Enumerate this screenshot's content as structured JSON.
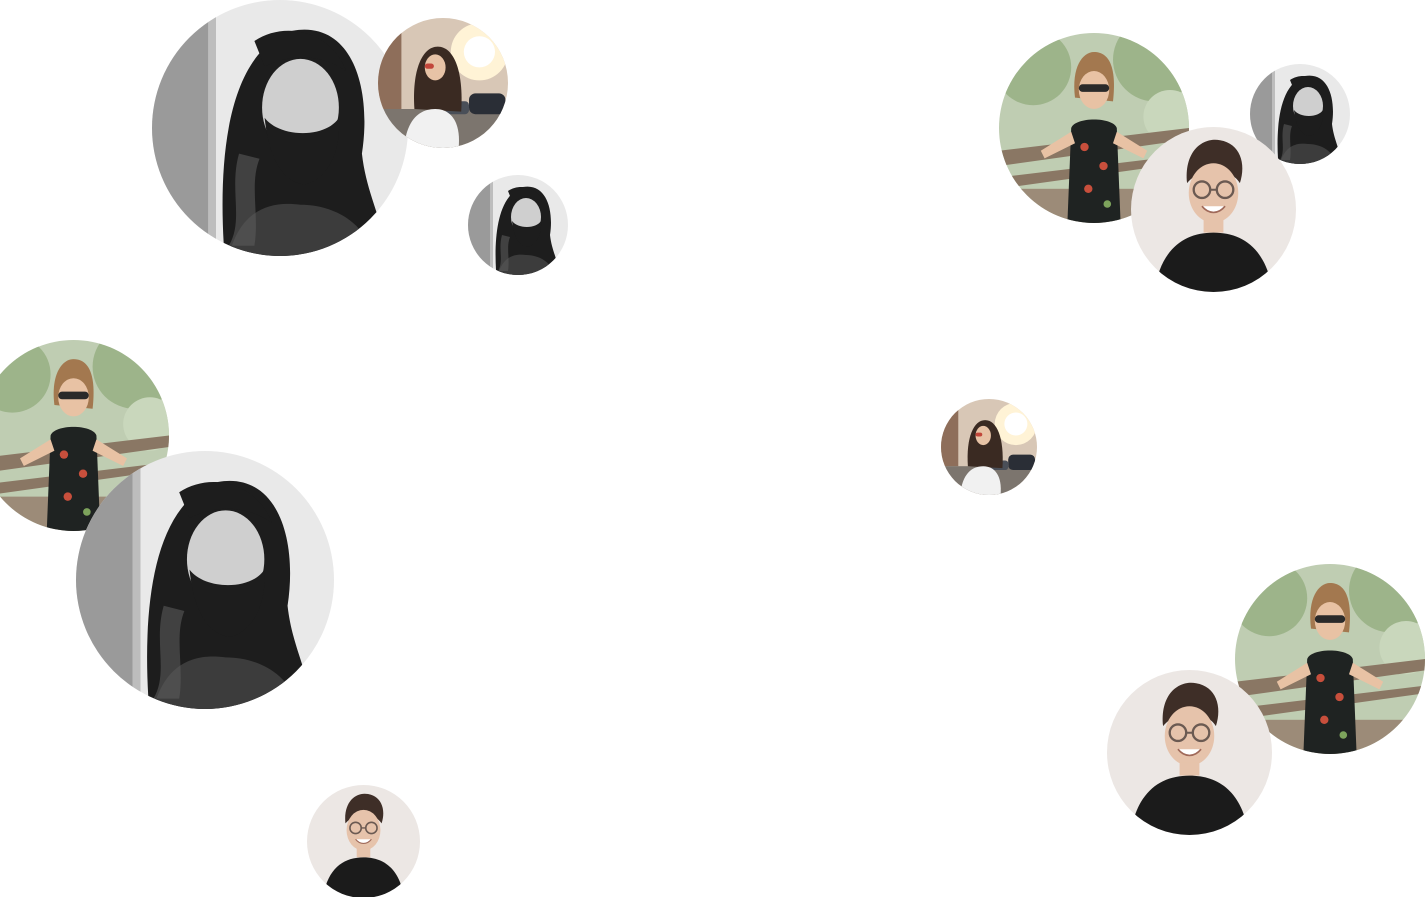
{
  "palette": {
    "background": "#ffffff",
    "bw_bg": "#e9e9e9",
    "bw_wall": "#9a9a9a",
    "bw_hair": "#1d1d1d",
    "bw_skin": "#cfcfcf",
    "bw_shirt": "#3c3c3c",
    "street_bg": "#d8c7b6",
    "street_sun": "#fff3d6",
    "street_hair": "#3a2a22",
    "street_skin": "#e7c3a6",
    "street_top": "#f1f1f1",
    "street_car": "#2a2e36",
    "park_bg": "#bfcdb2",
    "park_leaf": "#9db48a",
    "park_hair": "#a3784f",
    "park_skin": "#e8c2a4",
    "park_dress": "#1f2322",
    "park_print": "#c84f3c",
    "park_rail": "#8a7764",
    "studio_bg": "#ece7e4",
    "studio_hair": "#3e2e27",
    "studio_skin": "#e6c3ab",
    "studio_shirt": "#1b1b1b",
    "studio_glasses": "#6b5a52"
  },
  "avatars": [
    {
      "id": "a1",
      "photo": "bearded-man-bw"
    },
    {
      "id": "a2",
      "photo": "woman-street-sunlight"
    },
    {
      "id": "a3",
      "photo": "bearded-man-bw"
    },
    {
      "id": "a4",
      "photo": "woman-park-thumbs-up"
    },
    {
      "id": "a5",
      "photo": "man-glasses-studio"
    },
    {
      "id": "a6",
      "photo": "bearded-man-bw"
    },
    {
      "id": "a7",
      "photo": "woman-park-thumbs-up"
    },
    {
      "id": "a8",
      "photo": "bearded-man-bw"
    },
    {
      "id": "a9",
      "photo": "woman-street-sunlight"
    },
    {
      "id": "a10",
      "photo": "woman-park-thumbs-up"
    },
    {
      "id": "a11",
      "photo": "man-glasses-studio"
    },
    {
      "id": "a12",
      "photo": "man-glasses-studio"
    }
  ]
}
